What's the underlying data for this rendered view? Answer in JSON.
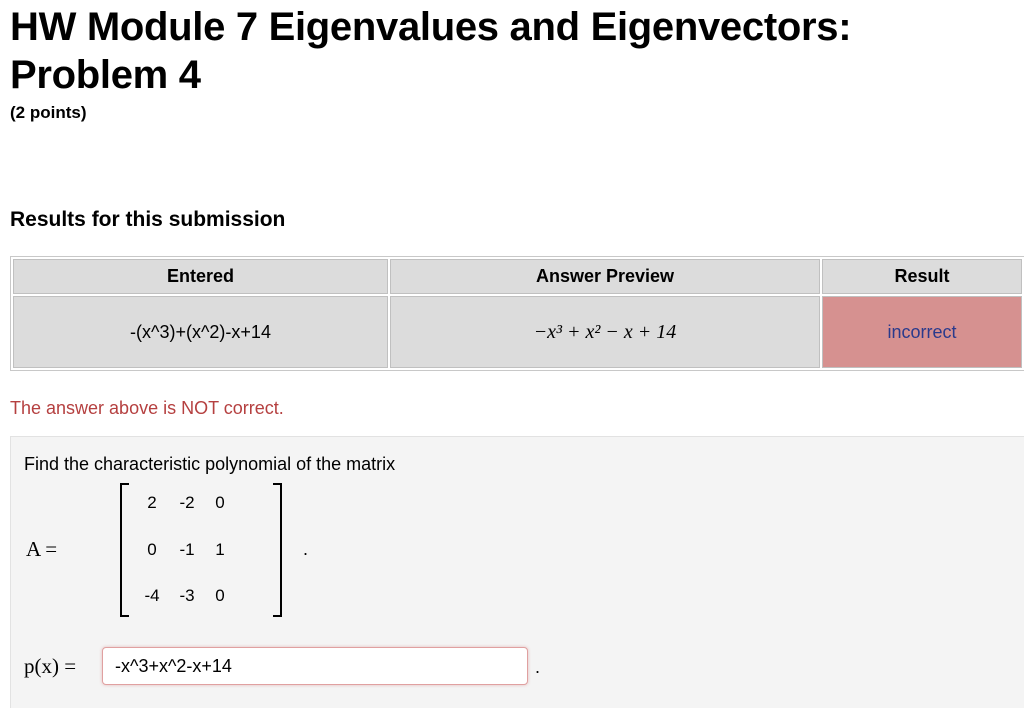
{
  "header": {
    "title": "HW Module 7 Eigenvalues and Eigenvectors: Problem 4",
    "points": "(2 points)"
  },
  "results": {
    "heading": "Results for this submission",
    "columns": [
      "Entered",
      "Answer Preview",
      "Result"
    ],
    "row": {
      "entered": "-(x^3)+(x^2)-x+14",
      "preview": "−x³ + x² − x + 14",
      "result": "incorrect"
    },
    "status_message": "The answer above is NOT correct."
  },
  "problem": {
    "prompt": "Find the characteristic polynomial of the matrix",
    "matrix_label": "A =",
    "matrix": [
      [
        "2",
        "-2",
        "0"
      ],
      [
        "0",
        "-1",
        "1"
      ],
      [
        "-4",
        "-3",
        "0"
      ]
    ],
    "matrix_end": ".",
    "answer_label": "p(x) =",
    "answer_value": "-x^3+x^2-x+14",
    "answer_end": "."
  },
  "colors": {
    "incorrect_bg": "#d69190",
    "incorrect_text": "#2a3a8c",
    "error_message": "#b54040",
    "cell_bg": "#dcdcdc"
  }
}
